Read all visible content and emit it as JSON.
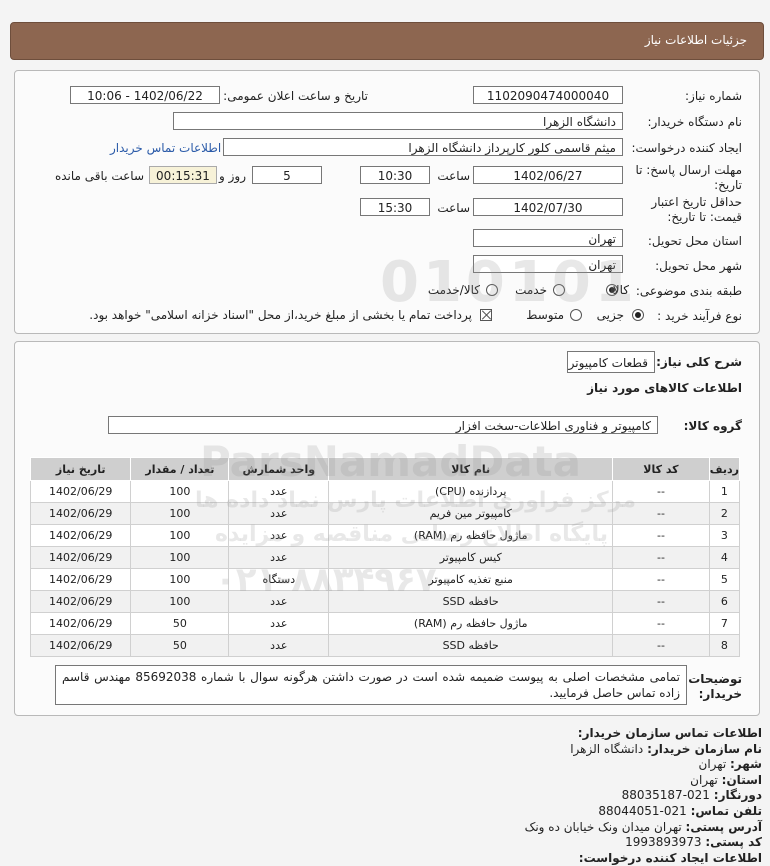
{
  "header": {
    "title": "جزئیات اطلاعات نیاز"
  },
  "details": {
    "need_number_label": "شماره نیاز:",
    "need_number": "1102090474000040",
    "announce_label": "تاریخ و ساعت اعلان عمومی:",
    "announce_value": "1402/06/22 - 10:06",
    "buyer_org_label": "نام دستگاه خریدار:",
    "buyer_org": "دانشگاه الزهرا",
    "creator_label": "ایجاد کننده درخواست:",
    "creator": "میثم  قاسمی کلور کارپرداز دانشگاه الزهرا",
    "contact_link": "اطلاعات تماس خریدار",
    "deadline_label": "مهلت ارسال پاسخ: تا تاریخ:",
    "deadline_date": "1402/06/27",
    "time_label": "ساعت",
    "deadline_time": "10:30",
    "days": "5",
    "days_label": "روز و",
    "remaining_time": "00:15:31",
    "remaining_label": "ساعت باقی مانده",
    "validity_label": "حداقل تاریخ اعتبار قیمت: تا تاریخ:",
    "validity_date": "1402/07/30",
    "validity_time": "15:30",
    "province_label": "استان محل تحویل:",
    "province": "تهران",
    "city_label": "شهر محل تحویل:",
    "city": "تهران",
    "category_label": "طبقه بندی موضوعی:",
    "category_options": [
      "کالا",
      "خدمت",
      "کالا/خدمت"
    ],
    "category_selected": "کالا",
    "process_label": "نوع فرآیند خرید :",
    "process_options": [
      "جزیی",
      "متوسط"
    ],
    "process_selected": "جزیی",
    "payment_note": "پرداخت تمام یا بخشی از مبلغ خرید،از محل \"اسناد خزانه اسلامی\" خواهد بود."
  },
  "summary": {
    "general_desc_label": "شرح کلی نیاز:",
    "general_desc": "قطعات کامپیوتر",
    "goods_info_title": "اطلاعات کالاهای مورد نیاز",
    "group_label": "گروه کالا:",
    "group_value": "کامپیوتر و فناوری اطلاعات-سخت افزار"
  },
  "table": {
    "headers": [
      "ردیف",
      "کد کالا",
      "نام کالا",
      "واحد شمارش",
      "تعداد / مقدار",
      "تاریخ نیاز"
    ],
    "rows": [
      [
        "1",
        "--",
        "پردازنده (CPU)",
        "عدد",
        "100",
        "1402/06/29"
      ],
      [
        "2",
        "--",
        "کامپیوتر مین فریم",
        "عدد",
        "100",
        "1402/06/29"
      ],
      [
        "3",
        "--",
        "ماژول حافظه رم (RAM)",
        "عدد",
        "100",
        "1402/06/29"
      ],
      [
        "4",
        "--",
        "کیس کامپیوتر",
        "عدد",
        "100",
        "1402/06/29"
      ],
      [
        "5",
        "--",
        "منبع تغذیه کامپیوتر",
        "دستگاه",
        "100",
        "1402/06/29"
      ],
      [
        "6",
        "--",
        "حافظه SSD",
        "عدد",
        "100",
        "1402/06/29"
      ],
      [
        "7",
        "--",
        "ماژول حافظه رم (RAM)",
        "عدد",
        "50",
        "1402/06/29"
      ],
      [
        "8",
        "--",
        "حافظه SSD",
        "عدد",
        "50",
        "1402/06/29"
      ]
    ]
  },
  "buyer_notes": {
    "label_line1": "توضیحات",
    "label_line2": "خریدار:",
    "text": "تمامی مشخصات اصلی به پیوست ضمیمه شده است در صورت داشتن هرگونه سوال با شماره 85692038 مهندس قاسم زاده تماس حاصل فرمایید."
  },
  "contact": {
    "title": "اطلاعات تماس سازمان خریدار:",
    "org_label": "نام سازمان خریدار:",
    "org": "دانشگاه الزهرا",
    "city_label": "شهر:",
    "city": "تهران",
    "province_label": "استان:",
    "province": "تهران",
    "fax_label": "دورنگار:",
    "fax": "021-88035187",
    "phone_label": "تلفن تماس:",
    "phone": "021-88044051",
    "address_label": "آدرس پستی:",
    "address": "تهران میدان ونک خیابان ده ونک",
    "postal_label": "کد پستی:",
    "postal": "1993893973",
    "creator_info_partial": "اطلاعات ایجاد کننده درخواست:"
  },
  "watermark": {
    "brand": "ParsNamadData",
    "line1": "مرکز فراوری اطلاعات پارس نماد داده ها",
    "line2": "پایگاه اطلاع رسانی مناقصه و مزایده",
    "phone": "۰۲۱-۸۸۳۴۹۶۷۰",
    "digits": "010101"
  }
}
